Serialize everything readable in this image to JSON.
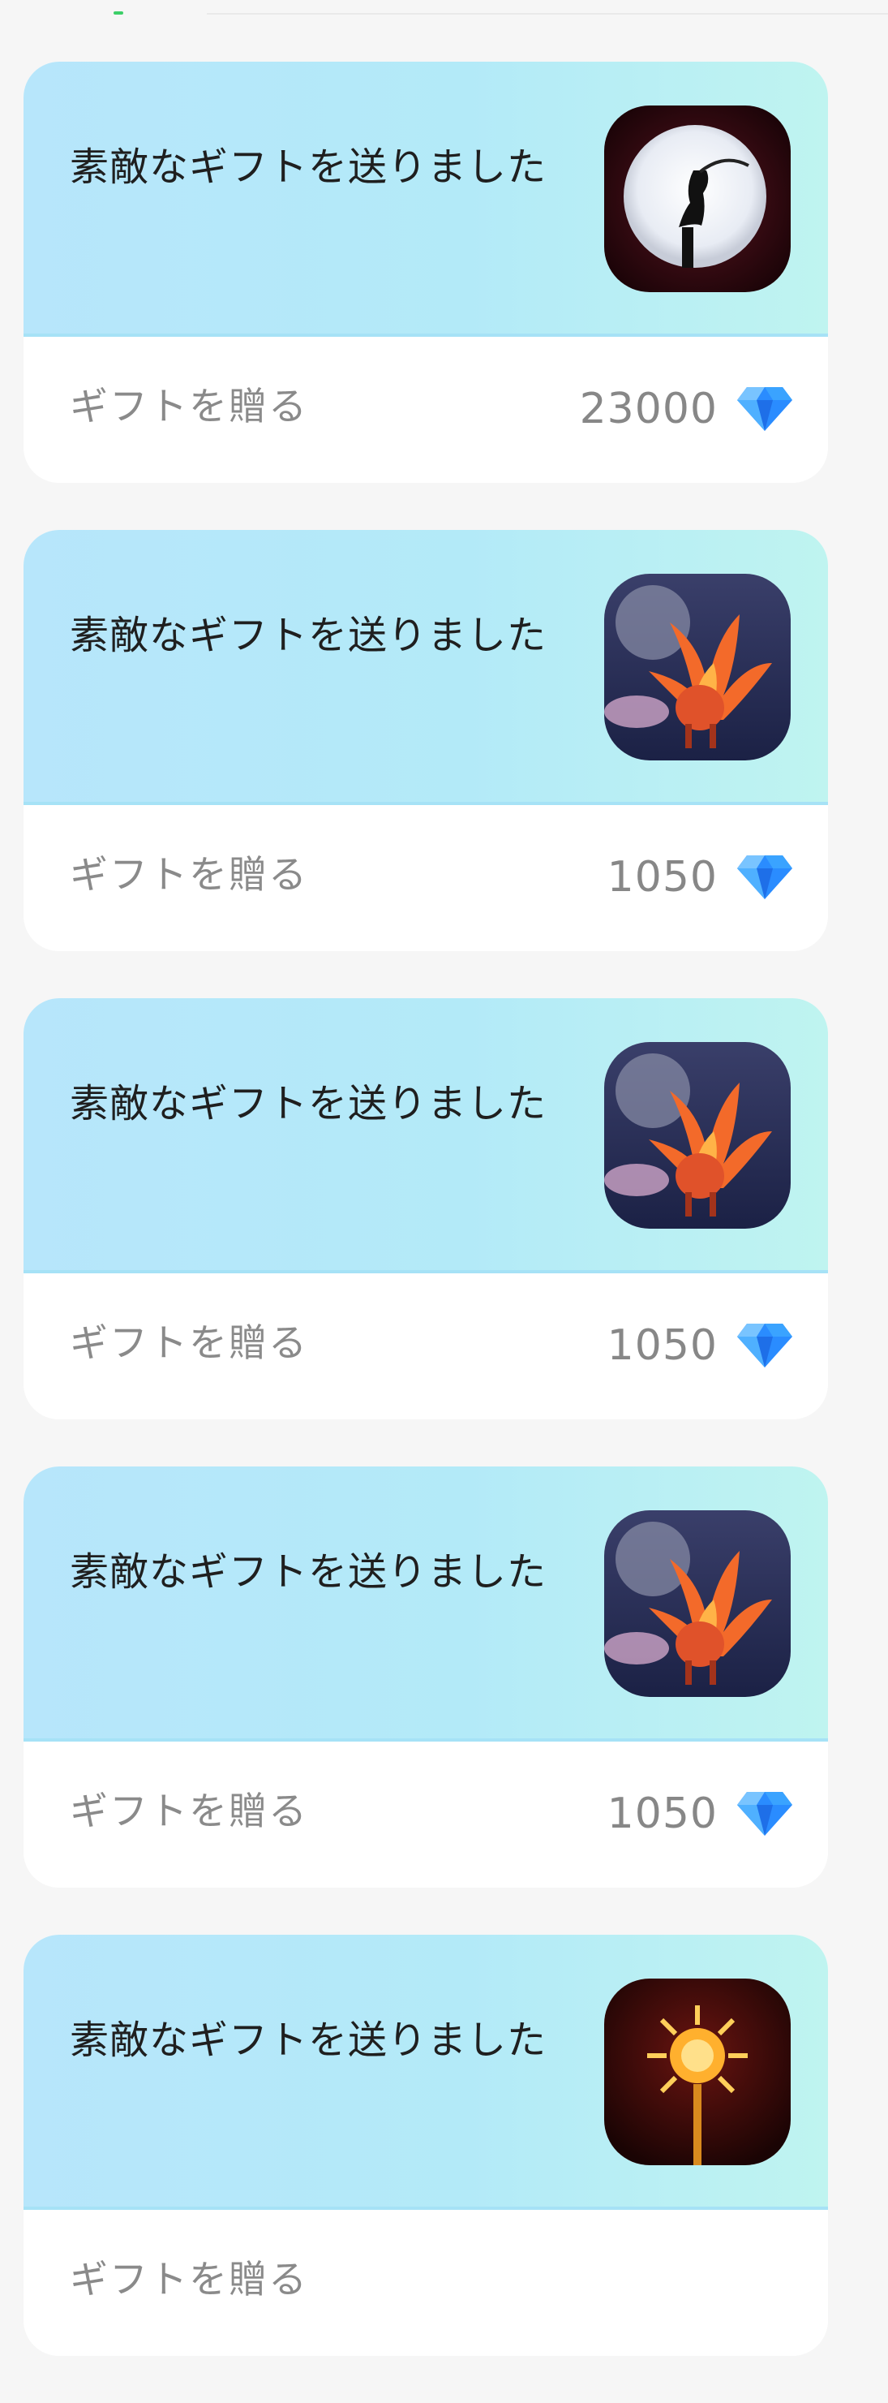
{
  "gifts": [
    {
      "title": "素敵なギフトを送りました",
      "action_label": "ギフトを贈る",
      "price": "23000",
      "image": "moon-silhouette-gift"
    },
    {
      "title": "素敵なギフトを送りました",
      "action_label": "ギフトを贈る",
      "price": "1050",
      "image": "nine-tailed-fox-gift"
    },
    {
      "title": "素敵なギフトを送りました",
      "action_label": "ギフトを贈る",
      "price": "1050",
      "image": "nine-tailed-fox-gift"
    },
    {
      "title": "素敵なギフトを送りました",
      "action_label": "ギフトを贈る",
      "price": "1050",
      "image": "nine-tailed-fox-gift"
    },
    {
      "title": "素敵なギフトを送りました",
      "action_label": "ギフトを贈る",
      "price": "",
      "image": "golden-sun-wand-gift"
    }
  ],
  "currency_icon": "diamond-icon",
  "colors": {
    "card_gradient_start": "#b7e6fb",
    "card_gradient_end": "#bff4f0",
    "diamond": "#1e8fff"
  }
}
